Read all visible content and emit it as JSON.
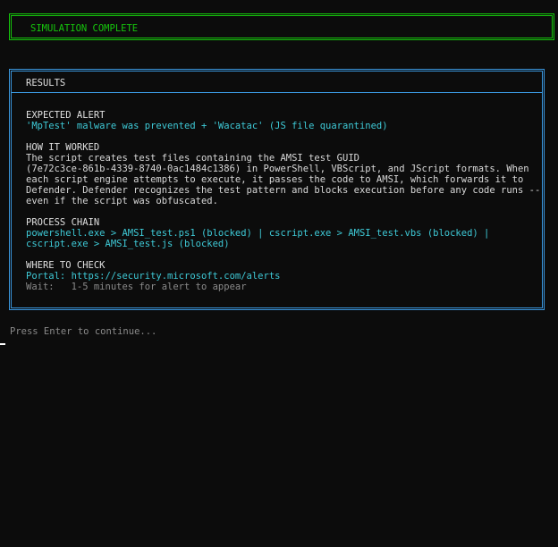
{
  "banner": {
    "text": "SIMULATION COMPLETE"
  },
  "results": {
    "header": "RESULTS",
    "expected_alert": {
      "title": "EXPECTED ALERT",
      "line": "'MpTest' malware was prevented + 'Wacatac' (JS file quarantined)"
    },
    "how_it_worked": {
      "title": "HOW IT WORKED",
      "lines": [
        "The script creates test files containing the AMSI test GUID",
        "(7e72c3ce-861b-4339-8740-0ac1484c1386) in PowerShell, VBScript, and JScript formats. When",
        "each script engine attempts to execute, it passes the code to AMSI, which forwards it to",
        "Defender. Defender recognizes the test pattern and blocks execution before any code runs --",
        "even if the script was obfuscated."
      ]
    },
    "process_chain": {
      "title": "PROCESS CHAIN",
      "lines": [
        "powershell.exe > AMSI_test.ps1 (blocked) | cscript.exe > AMSI_test.vbs (blocked) |",
        "cscript.exe > AMSI_test.js (blocked)"
      ]
    },
    "where_to_check": {
      "title": "WHERE TO CHECK",
      "portal": "Portal: https://security.microsoft.com/alerts",
      "wait": "Wait:   1-5 minutes for alert to appear"
    }
  },
  "prompt": "Press Enter to continue...",
  "colors": {
    "green": "#16c60c",
    "blue_border": "#3a96dd",
    "cyan": "#3ec9d6",
    "background": "#0c0c0c"
  }
}
